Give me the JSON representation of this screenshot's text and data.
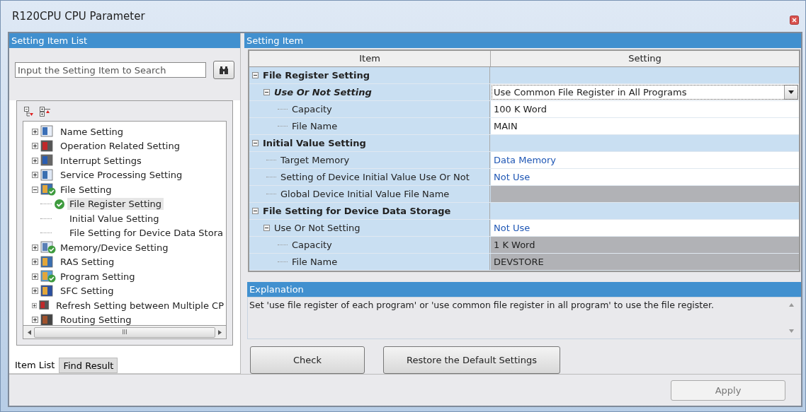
{
  "window": {
    "title": "R120CPU CPU Parameter"
  },
  "left_panel": {
    "title": "Setting Item List",
    "search": {
      "placeholder": "Input the Setting Item to Search"
    },
    "tree": [
      {
        "label": "Name Setting",
        "kind": "list",
        "expanded": false,
        "checked": false,
        "selected": false
      },
      {
        "label": "Operation Related Setting",
        "kind": "cpu",
        "expanded": false,
        "checked": false,
        "selected": false
      },
      {
        "label": "Interrupt Settings",
        "kind": "arrow",
        "expanded": false,
        "checked": false,
        "selected": false
      },
      {
        "label": "Service Processing Setting",
        "kind": "grid",
        "expanded": false,
        "checked": false,
        "selected": false
      },
      {
        "label": "File Setting",
        "kind": "folder",
        "expanded": true,
        "checked": true,
        "selected": false,
        "children": [
          {
            "label": "File Register Setting",
            "checked": true,
            "selected": true
          },
          {
            "label": "Initial Value Setting",
            "checked": false,
            "selected": false
          },
          {
            "label": "File Setting for Device Data Stora",
            "checked": false,
            "selected": false
          }
        ]
      },
      {
        "label": "Memory/Device Setting",
        "kind": "memory",
        "expanded": false,
        "checked": true,
        "selected": false
      },
      {
        "label": "RAS Setting",
        "kind": "folder",
        "expanded": false,
        "checked": false,
        "selected": false
      },
      {
        "label": "Program Setting",
        "kind": "program",
        "expanded": false,
        "checked": true,
        "selected": false
      },
      {
        "label": "SFC Setting",
        "kind": "sfc",
        "expanded": false,
        "checked": false,
        "selected": false
      },
      {
        "label": "Refresh Setting between Multiple CP",
        "kind": "cpu",
        "expanded": false,
        "checked": false,
        "selected": false
      },
      {
        "label": "Routing Setting",
        "kind": "route",
        "expanded": false,
        "checked": false,
        "selected": false
      }
    ],
    "scroll_glyph": "III",
    "tabs": [
      {
        "label": "Item List",
        "selected": true
      },
      {
        "label": "Find Result",
        "selected": false
      }
    ]
  },
  "setting_item": {
    "title": "Setting Item",
    "columns": [
      "Item",
      "Setting"
    ],
    "rows": [
      {
        "label": "File Register Setting",
        "kind": "group",
        "expanded": true,
        "children": [
          {
            "label": "Use Or Not Setting",
            "kind": "dropdown",
            "value": "Use Common File Register in All Programs",
            "selected": true,
            "expanded": true,
            "changed": false,
            "disabled": false,
            "children": [
              {
                "label": "Capacity",
                "kind": "text",
                "value": "100 K Word",
                "selected": false,
                "changed": false,
                "disabled": false
              },
              {
                "label": "File Name",
                "kind": "text",
                "value": "MAIN",
                "selected": false,
                "changed": false,
                "disabled": false
              }
            ]
          }
        ]
      },
      {
        "label": "Initial Value Setting",
        "kind": "group",
        "expanded": true,
        "children": [
          {
            "label": "Target Memory",
            "kind": "text",
            "value": "Data Memory",
            "selected": false,
            "changed": true,
            "disabled": false
          },
          {
            "label": "Setting of Device Initial Value Use Or Not",
            "kind": "text",
            "value": "Not Use",
            "selected": false,
            "changed": true,
            "disabled": false
          },
          {
            "label": "Global Device Initial Value File Name",
            "kind": "text",
            "selected": false,
            "changed": false,
            "disabled": true
          }
        ]
      },
      {
        "label": "File Setting for Device Data Storage",
        "kind": "group",
        "expanded": true,
        "children": [
          {
            "label": "Use Or Not Setting",
            "kind": "text",
            "value": "Not Use",
            "selected": false,
            "expanded": true,
            "changed": true,
            "disabled": false,
            "children": [
              {
                "label": "Capacity",
                "kind": "text",
                "value": "1 K Word",
                "selected": false,
                "changed": false,
                "disabled": true
              },
              {
                "label": "File Name",
                "kind": "text",
                "value": "DEVSTORE",
                "selected": false,
                "changed": false,
                "disabled": true
              }
            ]
          }
        ]
      }
    ]
  },
  "explanation": {
    "title": "Explanation",
    "text": "Set 'use file register of each program' or 'use common file register in all program' to use the file register."
  },
  "buttons": [
    {
      "label": "Check",
      "disabled": false
    },
    {
      "label": "Restore the Default Settings",
      "disabled": false
    }
  ],
  "apply_button": {
    "label": "Apply",
    "disabled": true
  }
}
